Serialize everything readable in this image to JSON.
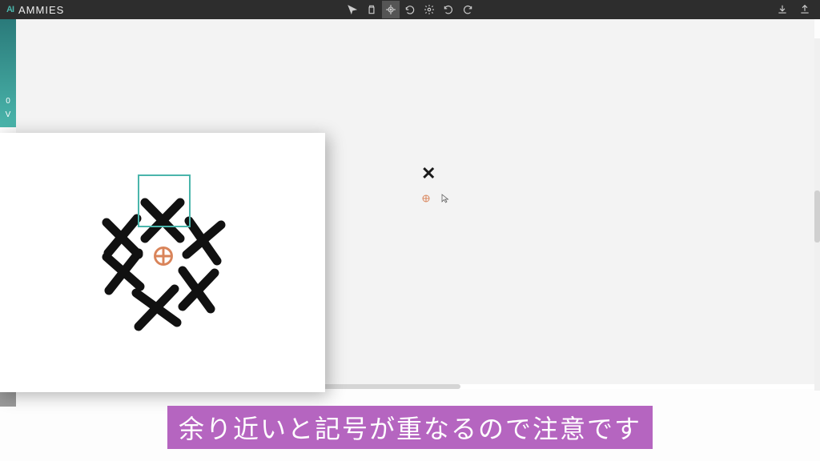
{
  "app": {
    "title": "AMMIES"
  },
  "sidebar": {
    "label_top": "0",
    "label_bottom": "V"
  },
  "caption": {
    "text": "余り近いと記号が重なるので注意です"
  }
}
